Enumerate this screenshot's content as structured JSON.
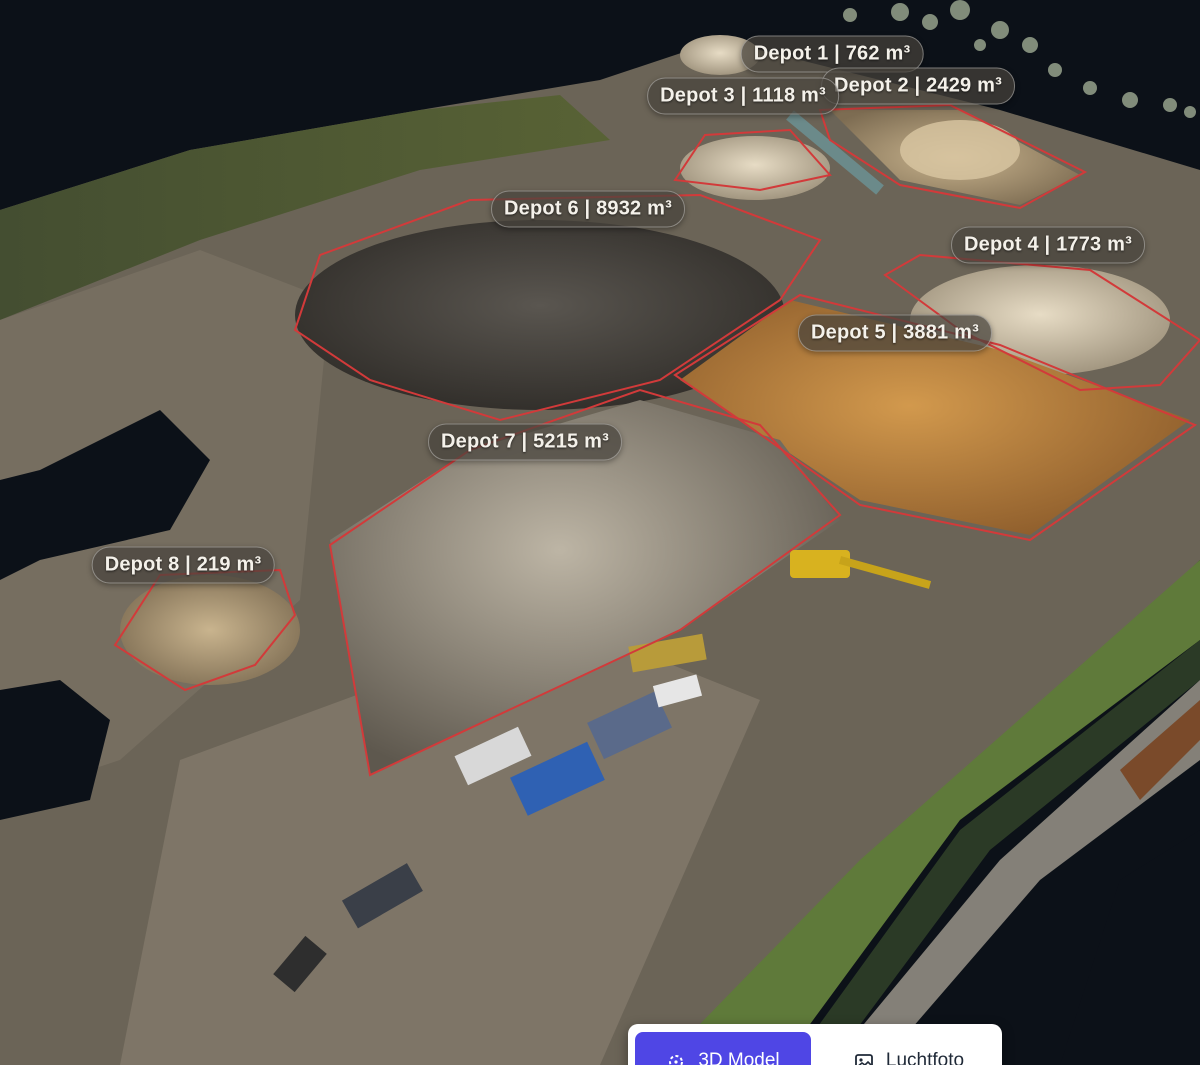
{
  "depots": [
    {
      "id": 1,
      "label": "Depot 1 | 762 m³"
    },
    {
      "id": 2,
      "label": "Depot 2 | 2429 m³"
    },
    {
      "id": 3,
      "label": "Depot 3 | 1118 m³"
    },
    {
      "id": 4,
      "label": "Depot 4 | 1773 m³"
    },
    {
      "id": 5,
      "label": "Depot 5 | 3881 m³"
    },
    {
      "id": 6,
      "label": "Depot 6 | 8932 m³"
    },
    {
      "id": 7,
      "label": "Depot 7 | 5215 m³"
    },
    {
      "id": 8,
      "label": "Depot 8 | 219 m³"
    }
  ],
  "view_toggle": {
    "model_3d": {
      "label": "3D Model",
      "icon": "3d-model-icon",
      "active": true
    },
    "aerial": {
      "label": "Luchtfoto",
      "icon": "image-icon",
      "active": false
    }
  },
  "colors": {
    "accent": "#4f46e5",
    "depot_outline": "#d23a3a",
    "background": "#0c1118"
  }
}
